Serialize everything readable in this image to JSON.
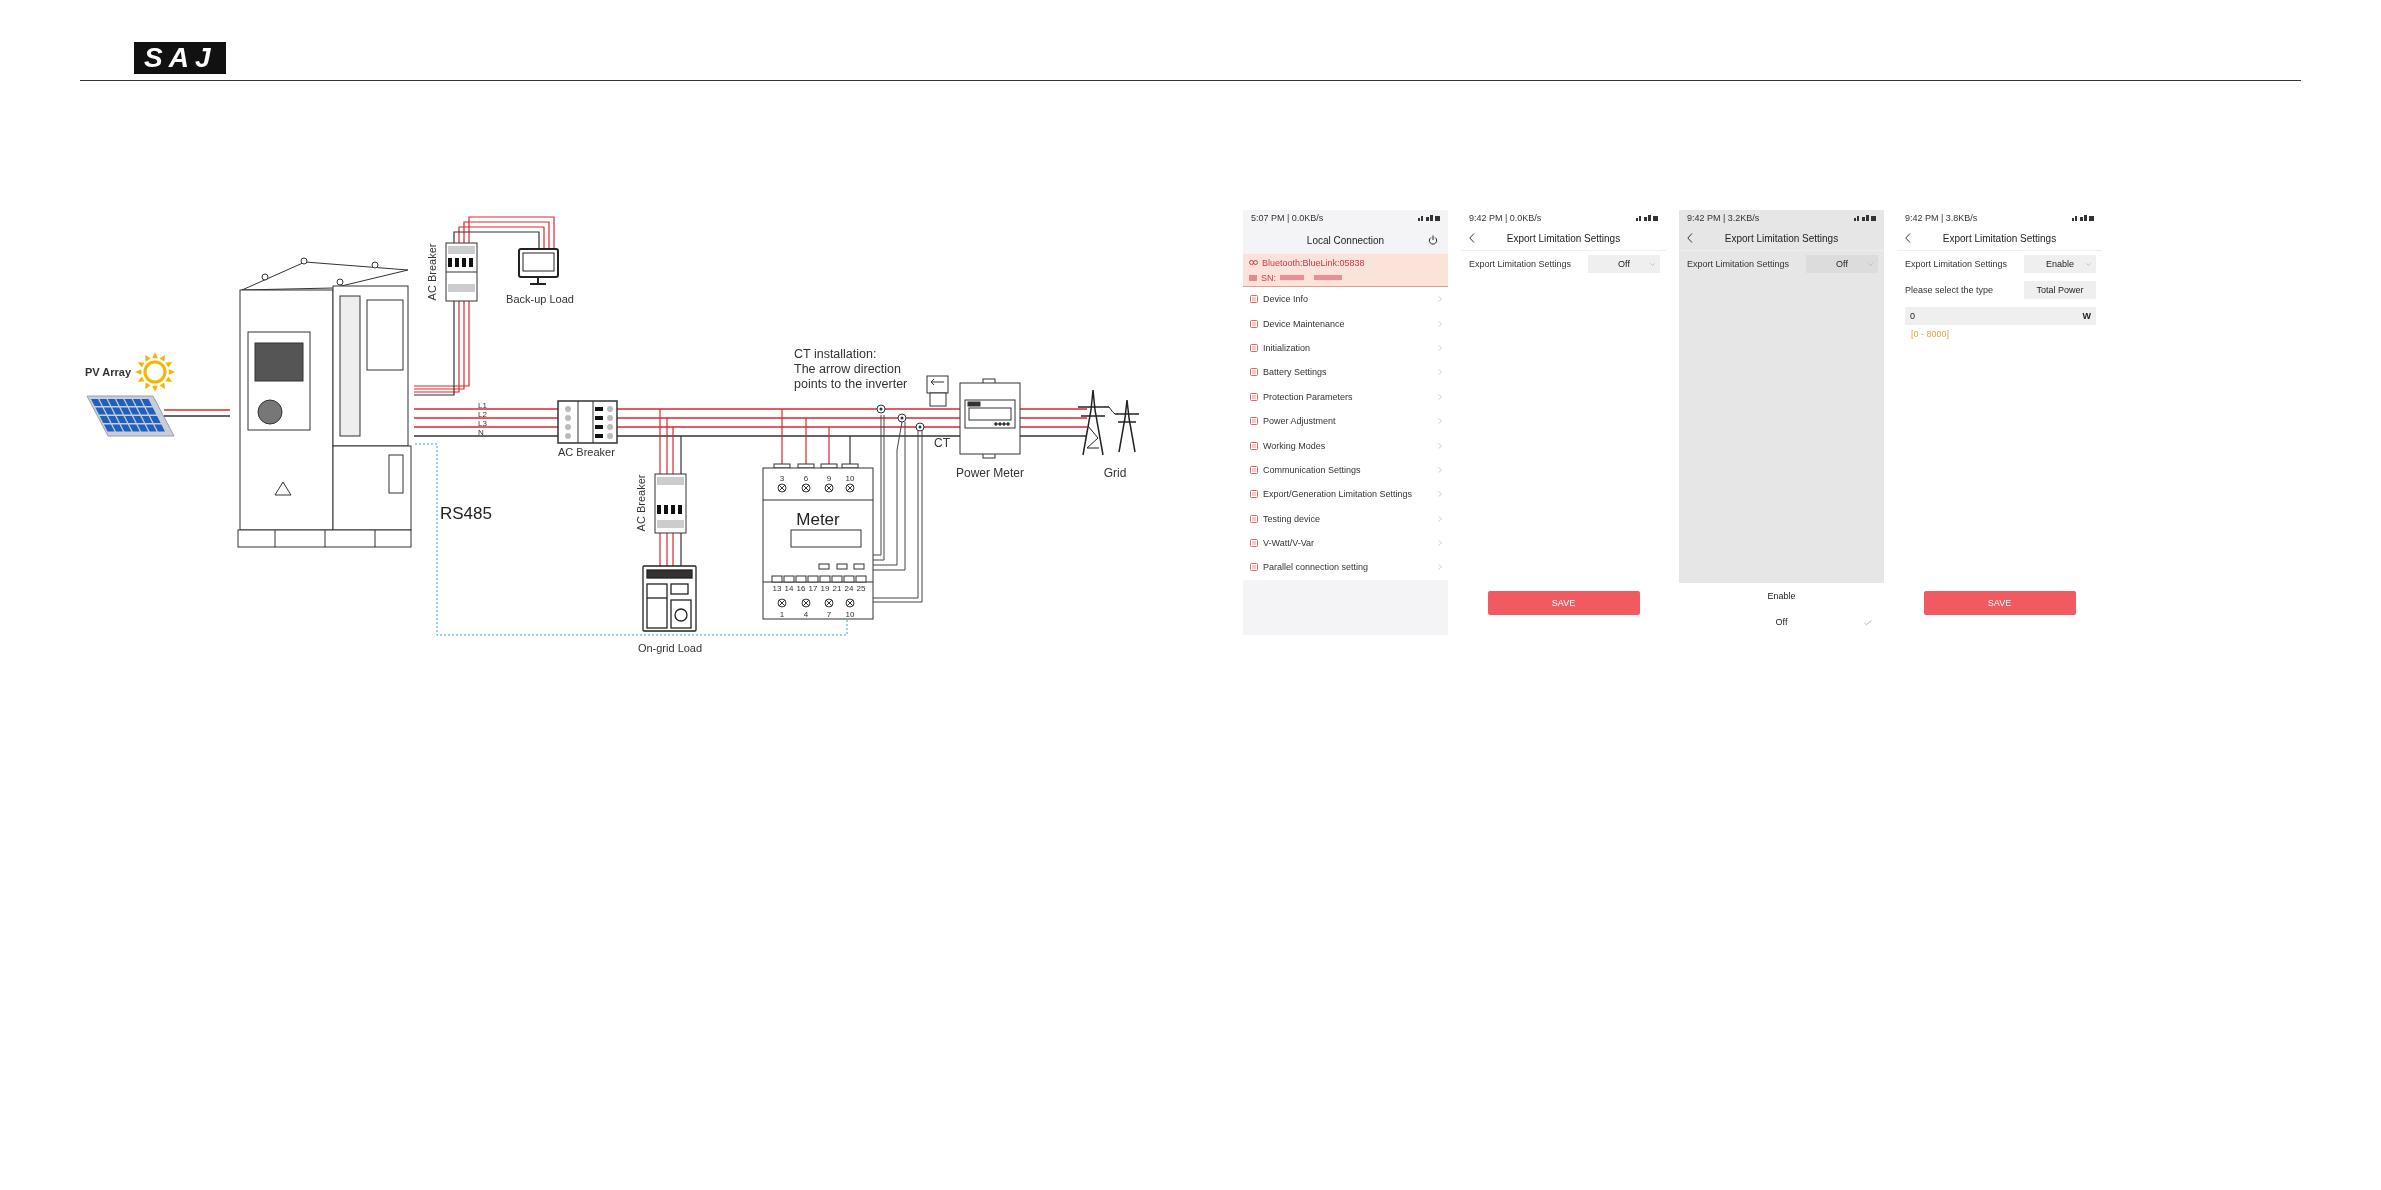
{
  "header": {
    "logo": "SAJ"
  },
  "diagram": {
    "pv_array": "PV Array",
    "backup_breaker": "AC Breaker",
    "backup_load": "Back-up Load",
    "phases": [
      "L1",
      "L2",
      "L3",
      "N"
    ],
    "main_breaker": "AC Breaker",
    "rs485": "RS485",
    "ongrid_breaker": "AC Breaker",
    "ongrid_load": "On-grid Load",
    "meter": {
      "title": "Meter",
      "top_terminals": [
        "3",
        "6",
        "9",
        "10"
      ],
      "ct_terminals": [
        "13",
        "14",
        "16",
        "17",
        "19",
        "21",
        "24",
        "25"
      ],
      "bottom_terminals": [
        "1",
        "4",
        "7",
        "10"
      ]
    },
    "ct_note": [
      "CT installation:",
      "The arrow direction",
      "points to the inverter"
    ],
    "ct": "CT",
    "power_meter": "Power Meter",
    "grid": "Grid"
  },
  "phones": [
    {
      "kind": "menu",
      "status": "5:07 PM | 0.0KB/s",
      "title": "Local Connection",
      "connection": "Bluetooth:BlueLink:05838",
      "sn_label": "SN:",
      "items": [
        "Device Info",
        "Device Maintenance",
        "Initialization",
        "Battery Settings",
        "Protection Parameters",
        "Power Adjustment",
        "Working Modes",
        "Communication Settings",
        "Export/Generation Limitation Settings",
        "Testing device",
        "V-Watt/V-Var",
        "Parallel connection setting"
      ]
    },
    {
      "kind": "settings",
      "status": "9:42 PM | 0.0KB/s",
      "title": "Export Limitation Settings",
      "dimmed": false,
      "fields": [
        {
          "kind": "select",
          "label": "Export Limitation Settings",
          "value": "Off"
        }
      ],
      "button": "SAVE"
    },
    {
      "kind": "settings",
      "status": "9:42 PM | 3.2KB/s",
      "title": "Export Limitation Settings",
      "dimmed": true,
      "fields": [
        {
          "kind": "select",
          "label": "Export Limitation Settings",
          "value": "Off"
        }
      ],
      "sheet": [
        {
          "label": "Enable",
          "selected": false
        },
        {
          "label": "Off",
          "selected": true
        }
      ]
    },
    {
      "kind": "settings",
      "status": "9:42 PM | 3.8KB/s",
      "title": "Export Limitation Settings",
      "dimmed": false,
      "fields": [
        {
          "kind": "select",
          "label": "Export Limitation Settings",
          "value": "Enable"
        },
        {
          "kind": "choice",
          "label": "Please select the type",
          "value": "Total Power"
        },
        {
          "kind": "input",
          "value": "0",
          "unit": "W",
          "hint": "[0 - 8000]"
        }
      ],
      "button": "SAVE"
    }
  ]
}
